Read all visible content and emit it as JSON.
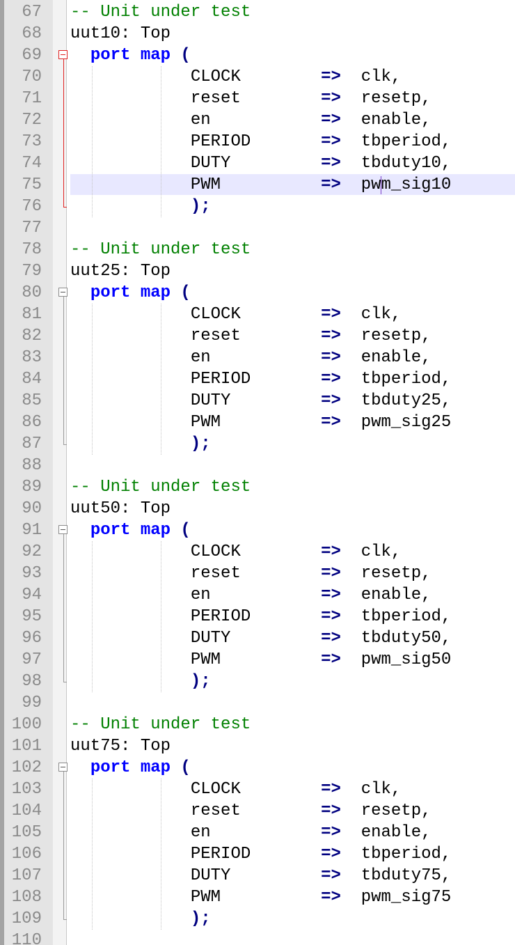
{
  "editor": {
    "language": "VHDL",
    "cursor_line": 75,
    "colors": {
      "comment": "#008000",
      "keyword": "#0000ff",
      "operator": "#000080",
      "line_number": "#8a8a8a",
      "current_line_highlight": "#e8e8ff",
      "gutter": "#e4e4e4",
      "fold_marker_active": "#e02020"
    },
    "lines": [
      {
        "num": "67",
        "kind": "comment",
        "text": "-- Unit under test"
      },
      {
        "num": "68",
        "kind": "label",
        "text": "uut10: Top"
      },
      {
        "num": "69",
        "kind": "portmap",
        "kw": "port map",
        "tail": " ("
      },
      {
        "num": "70",
        "kind": "assoc",
        "formal": "CLOCK",
        "arrow": "=>",
        "actual": "clk,"
      },
      {
        "num": "71",
        "kind": "assoc",
        "formal": "reset",
        "arrow": "=>",
        "actual": "resetp,"
      },
      {
        "num": "72",
        "kind": "assoc",
        "formal": "en",
        "arrow": "=>",
        "actual": "enable,"
      },
      {
        "num": "73",
        "kind": "assoc",
        "formal": "PERIOD",
        "arrow": "=>",
        "actual": "tbperiod,"
      },
      {
        "num": "74",
        "kind": "assoc",
        "formal": "DUTY",
        "arrow": "=>",
        "actual": "tbduty10,"
      },
      {
        "num": "75",
        "kind": "assoc",
        "formal": "PWM",
        "arrow": "=>",
        "actual": "pwm_sig10"
      },
      {
        "num": "76",
        "kind": "close",
        "text": ");"
      },
      {
        "num": "77",
        "kind": "blank",
        "text": ""
      },
      {
        "num": "78",
        "kind": "comment",
        "text": "-- Unit under test"
      },
      {
        "num": "79",
        "kind": "label",
        "text": "uut25: Top"
      },
      {
        "num": "80",
        "kind": "portmap",
        "kw": "port map",
        "tail": " ("
      },
      {
        "num": "81",
        "kind": "assoc",
        "formal": "CLOCK",
        "arrow": "=>",
        "actual": "clk,"
      },
      {
        "num": "82",
        "kind": "assoc",
        "formal": "reset",
        "arrow": "=>",
        "actual": "resetp,"
      },
      {
        "num": "83",
        "kind": "assoc",
        "formal": "en",
        "arrow": "=>",
        "actual": "enable,"
      },
      {
        "num": "84",
        "kind": "assoc",
        "formal": "PERIOD",
        "arrow": "=>",
        "actual": "tbperiod,"
      },
      {
        "num": "85",
        "kind": "assoc",
        "formal": "DUTY",
        "arrow": "=>",
        "actual": "tbduty25,"
      },
      {
        "num": "86",
        "kind": "assoc",
        "formal": "PWM",
        "arrow": "=>",
        "actual": "pwm_sig25"
      },
      {
        "num": "87",
        "kind": "close",
        "text": ");"
      },
      {
        "num": "88",
        "kind": "blank",
        "text": ""
      },
      {
        "num": "89",
        "kind": "comment",
        "text": "-- Unit under test"
      },
      {
        "num": "90",
        "kind": "label",
        "text": "uut50: Top"
      },
      {
        "num": "91",
        "kind": "portmap",
        "kw": "port map",
        "tail": " ("
      },
      {
        "num": "92",
        "kind": "assoc",
        "formal": "CLOCK",
        "arrow": "=>",
        "actual": "clk,"
      },
      {
        "num": "93",
        "kind": "assoc",
        "formal": "reset",
        "arrow": "=>",
        "actual": "resetp,"
      },
      {
        "num": "94",
        "kind": "assoc",
        "formal": "en",
        "arrow": "=>",
        "actual": "enable,"
      },
      {
        "num": "95",
        "kind": "assoc",
        "formal": "PERIOD",
        "arrow": "=>",
        "actual": "tbperiod,"
      },
      {
        "num": "96",
        "kind": "assoc",
        "formal": "DUTY",
        "arrow": "=>",
        "actual": "tbduty50,"
      },
      {
        "num": "97",
        "kind": "assoc",
        "formal": "PWM",
        "arrow": "=>",
        "actual": "pwm_sig50"
      },
      {
        "num": "98",
        "kind": "close",
        "text": ");"
      },
      {
        "num": "99",
        "kind": "blank",
        "text": ""
      },
      {
        "num": "100",
        "kind": "comment",
        "text": "-- Unit under test"
      },
      {
        "num": "101",
        "kind": "label",
        "text": "uut75: Top"
      },
      {
        "num": "102",
        "kind": "portmap",
        "kw": "port map",
        "tail": " ("
      },
      {
        "num": "103",
        "kind": "assoc",
        "formal": "CLOCK",
        "arrow": "=>",
        "actual": "clk,"
      },
      {
        "num": "104",
        "kind": "assoc",
        "formal": "reset",
        "arrow": "=>",
        "actual": "resetp,"
      },
      {
        "num": "105",
        "kind": "assoc",
        "formal": "en",
        "arrow": "=>",
        "actual": "enable,"
      },
      {
        "num": "106",
        "kind": "assoc",
        "formal": "PERIOD",
        "arrow": "=>",
        "actual": "tbperiod,"
      },
      {
        "num": "107",
        "kind": "assoc",
        "formal": "DUTY",
        "arrow": "=>",
        "actual": "tbduty75,"
      },
      {
        "num": "108",
        "kind": "assoc",
        "formal": "PWM",
        "arrow": "=>",
        "actual": "pwm_sig75"
      },
      {
        "num": "109",
        "kind": "close",
        "text": ");"
      },
      {
        "num": "110",
        "kind": "blank",
        "text": ""
      }
    ]
  }
}
